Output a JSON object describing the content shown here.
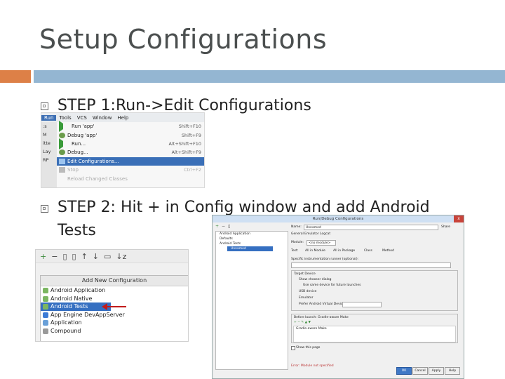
{
  "slide": {
    "title": "Setup Configurations",
    "colors": {
      "accent": "#dd8047",
      "band": "#94b6d2",
      "text": "#222222"
    }
  },
  "steps": [
    {
      "text": "STEP 1:Run->Edit Configurations"
    },
    {
      "line1": "STEP 2: Hit + in Config window and add Android",
      "line2": "Tests"
    }
  ],
  "run_menu": {
    "menubar": [
      "Run",
      "Tools",
      "VCS",
      "Window",
      "Help"
    ],
    "left_stub": [
      ":s",
      "M",
      "itte",
      "Lay",
      "RP"
    ],
    "items": [
      {
        "label": "Run 'app'",
        "shortcut": "Shift+F10",
        "icon": "run-icon"
      },
      {
        "label": "Debug 'app'",
        "shortcut": "Shift+F9",
        "icon": "debug-icon"
      },
      {
        "label": "Run...",
        "shortcut": "Alt+Shift+F10",
        "icon": "run-icon"
      },
      {
        "label": "Debug...",
        "shortcut": "Alt+Shift+F9",
        "icon": "debug-icon"
      },
      {
        "label": "Edit Configurations...",
        "shortcut": "",
        "icon": "edit-config-icon",
        "selected": true
      },
      {
        "label": "Stop",
        "shortcut": "Ctrl+F2",
        "icon": "stop-icon",
        "disabled": true
      },
      {
        "label": "Reload Changed Classes",
        "shortcut": "",
        "icon": "",
        "disabled": true
      }
    ]
  },
  "add_config": {
    "toolbar": [
      "+",
      "−",
      "▯",
      "▯",
      "↑",
      "↓",
      "▭",
      "↓z"
    ],
    "header": "Add New Configuration",
    "items": [
      {
        "label": "Android Application",
        "color": "#7bb661"
      },
      {
        "label": "Android Native",
        "color": "#7bb661"
      },
      {
        "label": "Android Tests",
        "color": "#7bb661",
        "selected": true
      },
      {
        "label": "App Engine DevAppServer",
        "color": "#3d7bd5"
      },
      {
        "label": "Application",
        "color": "#6aa0d8"
      },
      {
        "label": "Compound",
        "color": "#9a9a9a"
      }
    ]
  },
  "dialog": {
    "title": "Run/Debug Configurations",
    "close": "x",
    "tree": [
      "Android Application",
      "Defaults",
      "Android Tests",
      "Unnamed"
    ],
    "name_label": "Name:",
    "name_value": "Unnamed",
    "share": "Share",
    "tabs": "General  Emulator  Logcat",
    "module_label": "Module:",
    "module_value": "<no module>",
    "test_label": "Test:",
    "test_options": [
      "All in Module",
      "All in Package",
      "Class",
      "Method"
    ],
    "runner_label": "Specific instrumentation runner (optional):",
    "target_label": "Target Device",
    "target_options": [
      "Show chooser dialog",
      "Use same device for future launches",
      "USB device",
      "Emulator"
    ],
    "prefer_label": "Prefer Android Virtual Device:",
    "before_launch": "Before launch: Gradle-aware Make",
    "gradle_item": "Gradle-aware Make",
    "show_page": "Show this page",
    "error_text": "Error: Module not specified",
    "buttons": [
      "OK",
      "Cancel",
      "Apply",
      "Help"
    ]
  }
}
